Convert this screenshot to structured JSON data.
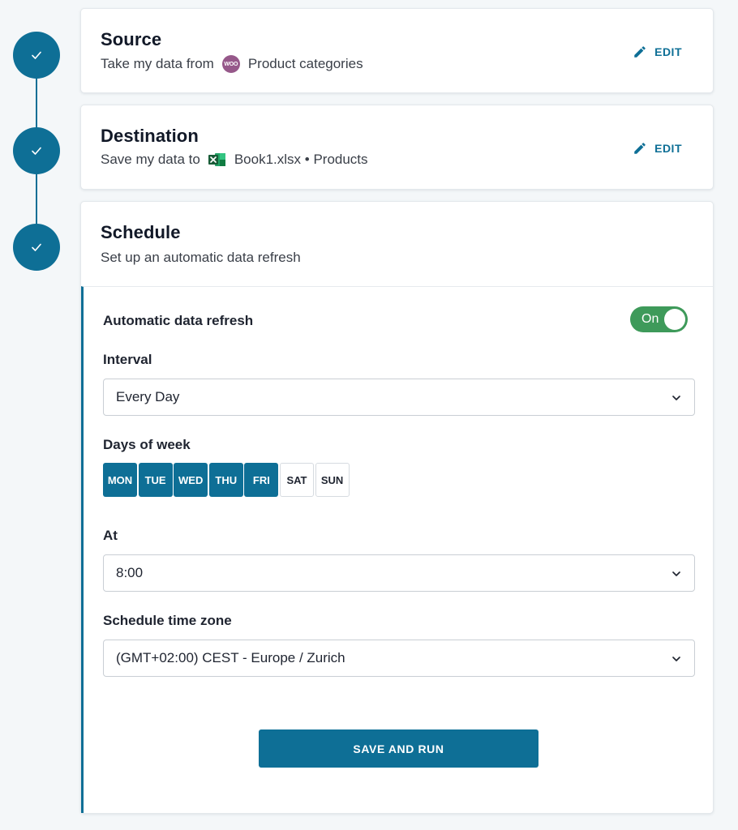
{
  "steps": [
    {
      "status": "complete"
    },
    {
      "status": "complete"
    },
    {
      "status": "complete"
    }
  ],
  "source": {
    "title": "Source",
    "prefix": "Take my data from",
    "icon": "woocommerce-icon",
    "icon_text": "WOO",
    "name": "Product categories",
    "edit_label": "EDIT"
  },
  "destination": {
    "title": "Destination",
    "prefix": "Save my data to",
    "icon": "excel-icon",
    "name": "Book1.xlsx • Products",
    "edit_label": "EDIT"
  },
  "schedule": {
    "title": "Schedule",
    "subtitle": "Set up an automatic data refresh",
    "auto_refresh_label": "Automatic data refresh",
    "toggle_label": "On",
    "interval_label": "Interval",
    "interval_value": "Every Day",
    "days_label": "Days of week",
    "days": [
      {
        "label": "MON",
        "selected": true
      },
      {
        "label": "TUE",
        "selected": true
      },
      {
        "label": "WED",
        "selected": true
      },
      {
        "label": "THU",
        "selected": true
      },
      {
        "label": "FRI",
        "selected": true
      },
      {
        "label": "SAT",
        "selected": false
      },
      {
        "label": "SUN",
        "selected": false
      }
    ],
    "at_label": "At",
    "at_value": "8:00",
    "timezone_label": "Schedule time zone",
    "timezone_value": "(GMT+02:00) CEST - Europe / Zurich",
    "save_label": "SAVE AND RUN"
  },
  "colors": {
    "accent": "#0e6f96",
    "toggle_on": "#3e9a5a",
    "woo": "#96588a",
    "excel": "#1d6f42"
  }
}
